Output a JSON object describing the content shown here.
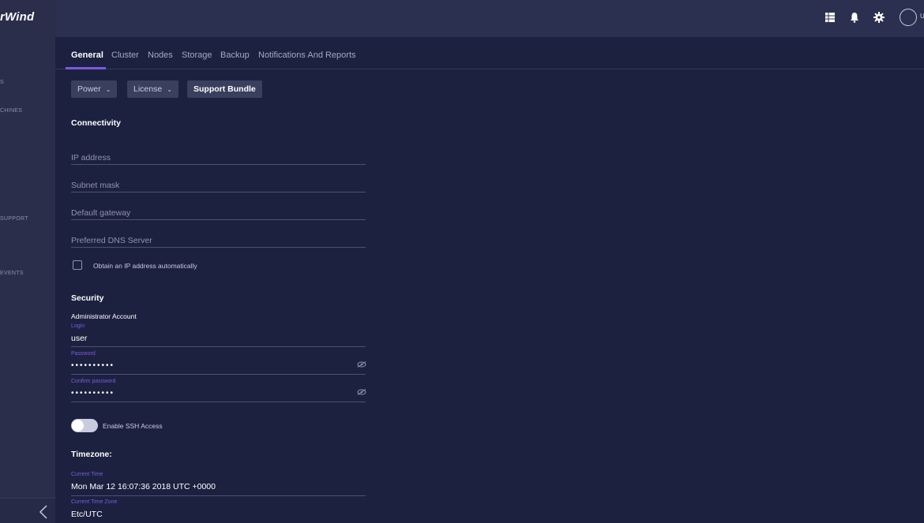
{
  "sidebar": {
    "brand": "rWind",
    "items": [
      "S",
      "CHINES",
      "SUPPORT",
      "EVENTS"
    ]
  },
  "header": {
    "icons": [
      "grid-icon",
      "bell-icon",
      "gear-icon",
      "avatar-icon"
    ],
    "user_label": "U"
  },
  "tabs": [
    {
      "label": "General",
      "active": true
    },
    {
      "label": "Cluster"
    },
    {
      "label": "Nodes"
    },
    {
      "label": "Storage"
    },
    {
      "label": "Backup"
    },
    {
      "label": "Notifications And Reports"
    }
  ],
  "actions": {
    "power": "Power",
    "license": "License",
    "support_bundle": "Support Bundle"
  },
  "connectivity": {
    "title": "Connectivity",
    "ip_placeholder": "IP address",
    "subnet_placeholder": "Subnet mask",
    "gateway_placeholder": "Default gateway",
    "dns_placeholder": "Preferred DNS Server",
    "auto_ip_label": "Obtain an IP address automatically"
  },
  "security": {
    "title": "Security",
    "admin_label": "Administrator Account",
    "login_label": "Login",
    "login_value": "user",
    "password_label": "Password",
    "password_value": "••••••••••",
    "confirm_label": "Confirm password",
    "confirm_value": "••••••••••",
    "ssh_label": "Enable SSH Access"
  },
  "timezone": {
    "title": "Timezone:",
    "current_time_label": "Current Time",
    "current_time_value": "Mon Mar 12 16:07:36 2018 UTC +0000",
    "current_zone_label": "Current Time Zone",
    "current_zone_value": "Etc/UTC"
  },
  "colors": {
    "accent": "#7b5be0",
    "background": "#1d2140",
    "header": "#2c3050",
    "sidebar": "#2a2e4b"
  }
}
